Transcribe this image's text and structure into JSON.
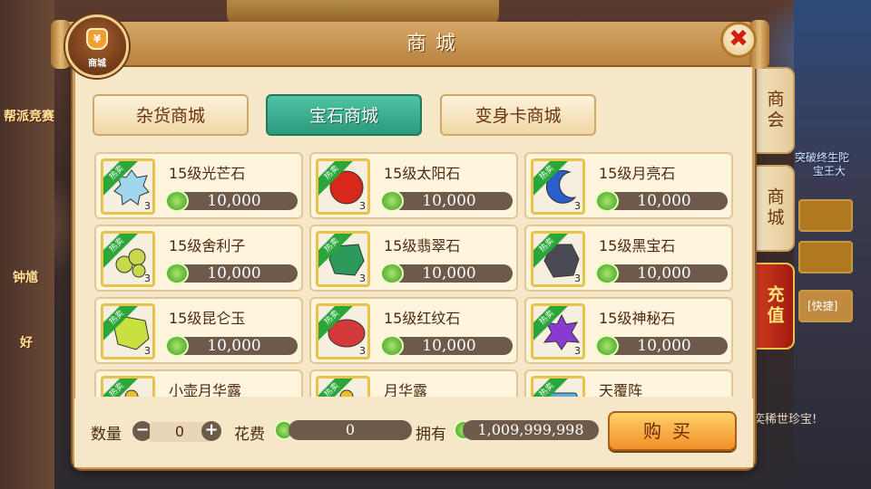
{
  "background": {
    "left_texts": [
      "帮派竞赛",
      "钟馗",
      "好"
    ],
    "right_texts": [
      "突破终生陀",
      "宝王大"
    ],
    "bottom_text": "奕稀世珍宝!",
    "right_box_text": "[快捷]"
  },
  "side_tabs": [
    "商会",
    "商城",
    "充值"
  ],
  "badge": {
    "label": "商城"
  },
  "title": "商城",
  "close_icon": "✖",
  "categories": [
    {
      "label": "杂货商城",
      "active": false
    },
    {
      "label": "宝石商城",
      "active": true
    },
    {
      "label": "变身卡商城",
      "active": false
    }
  ],
  "hot_tag": "热卖",
  "items": [
    {
      "name": "15级光芒石",
      "price": "10,000",
      "qty": "3",
      "icon": "crystal-gem-icon",
      "color": "#9fd6ee"
    },
    {
      "name": "15级太阳石",
      "price": "10,000",
      "qty": "3",
      "icon": "red-gem-icon",
      "color": "#d8281c"
    },
    {
      "name": "15级月亮石",
      "price": "10,000",
      "qty": "3",
      "icon": "moon-gem-icon",
      "color": "#2a5ec8"
    },
    {
      "name": "15级舍利子",
      "price": "10,000",
      "qty": "3",
      "icon": "pearl-gem-icon",
      "color": "#c8d84a"
    },
    {
      "name": "15级翡翠石",
      "price": "10,000",
      "qty": "3",
      "icon": "jade-gem-icon",
      "color": "#2c9a5a"
    },
    {
      "name": "15级黑宝石",
      "price": "10,000",
      "qty": "3",
      "icon": "black-gem-icon",
      "color": "#4a4a52"
    },
    {
      "name": "15级昆仑玉",
      "price": "10,000",
      "qty": "3",
      "icon": "kunlun-jade-icon",
      "color": "#c8e040"
    },
    {
      "name": "15级红纹石",
      "price": "10,000",
      "qty": "3",
      "icon": "red-pattern-gem-icon",
      "color": "#d23a3a"
    },
    {
      "name": "15级神秘石",
      "price": "10,000",
      "qty": "3",
      "icon": "mystery-gem-icon",
      "color": "#8a3ad0"
    },
    {
      "name": "小壶月华露",
      "price": "",
      "qty": "",
      "icon": "small-gourd-icon",
      "color": "#e8c02a"
    },
    {
      "name": "月华露",
      "price": "",
      "qty": "",
      "icon": "gourd-icon",
      "color": "#e8c02a"
    },
    {
      "name": "天覆阵",
      "price": "",
      "qty": "",
      "icon": "formation-scroll-icon",
      "color": "#5ab0d8"
    }
  ],
  "bottom": {
    "qty_label": "数量",
    "qty_value": "0",
    "minus": "−",
    "plus": "+",
    "cost_label": "花费",
    "cost_value": "0",
    "own_label": "拥有",
    "own_value": "1,009,999,998",
    "buy_label": "购买"
  }
}
